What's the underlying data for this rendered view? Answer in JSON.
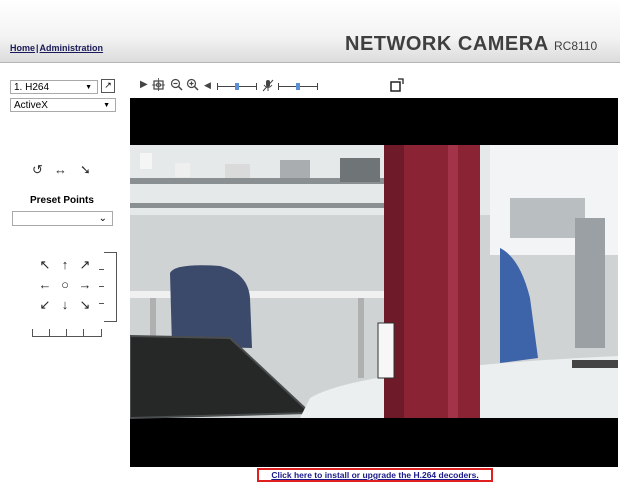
{
  "header": {
    "nav": {
      "home": "Home",
      "separator": "|",
      "administration": "Administration"
    },
    "brand": "NETWORK CAMERA",
    "model": "RC8110"
  },
  "controls": {
    "stream": {
      "selected": "1. H264"
    },
    "plugin": {
      "selected": "ActiveX"
    }
  },
  "toolbar": {
    "icons": [
      "play-icon",
      "snapshot-icon",
      "zoom-out-icon",
      "zoom-in-icon",
      "speaker-icon",
      "microphone-icon",
      "popout-icon"
    ]
  },
  "ptz": {
    "preset_label": "Preset Points",
    "preset_selected": ""
  },
  "footer": {
    "install_link": "Click here to install or upgrade the H.264 decoders."
  },
  "colors": {
    "accent": "#5b8fd6",
    "link": "#1a1a8a",
    "highlight_border": "#e02020",
    "brand_text": "#3f3f3f"
  }
}
